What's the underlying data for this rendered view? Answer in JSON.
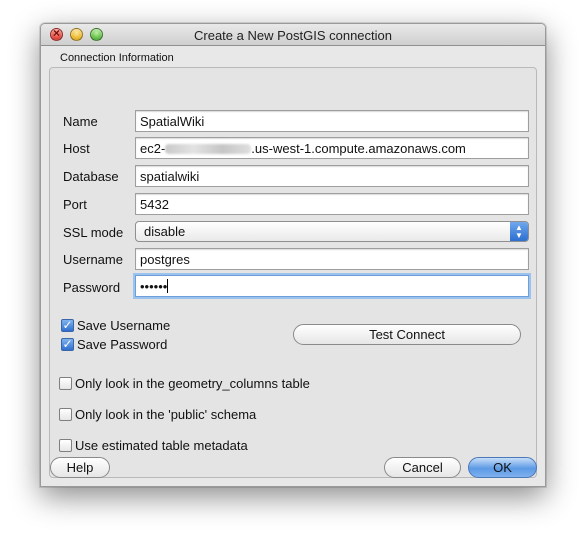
{
  "window": {
    "title": "Create a New PostGIS connection"
  },
  "group": {
    "label": "Connection Information"
  },
  "fields": {
    "name": {
      "label": "Name",
      "value": "SpatialWiki"
    },
    "host": {
      "label": "Host",
      "value_prefix": "ec2-",
      "value_suffix": ".us-west-1.compute.amazonaws.com"
    },
    "database": {
      "label": "Database",
      "value": "spatialwiki"
    },
    "port": {
      "label": "Port",
      "value": "5432"
    },
    "ssl_mode": {
      "label": "SSL mode",
      "value": "disable"
    },
    "username": {
      "label": "Username",
      "value": "postgres"
    },
    "password": {
      "label": "Password",
      "value": "••••••"
    }
  },
  "checkboxes": {
    "save_username": {
      "label": "Save Username",
      "checked": true
    },
    "save_password": {
      "label": "Save Password",
      "checked": true
    },
    "geometry_columns": {
      "label": "Only look in the geometry_columns table",
      "checked": false
    },
    "public_schema": {
      "label": "Only look in the 'public' schema",
      "checked": false
    },
    "estimated_metadata": {
      "label": "Use estimated table metadata",
      "checked": false
    }
  },
  "buttons": {
    "test_connect": "Test Connect",
    "help": "Help",
    "cancel": "Cancel",
    "ok": "OK"
  },
  "colors": {
    "accent": "#3b7fe0",
    "focus_ring": "#9cc2ee"
  },
  "icons": {
    "close": "close-icon",
    "minimize": "minimize-icon",
    "zoom": "zoom-icon",
    "select_arrows": "updown-arrows-icon",
    "check": "checkmark-icon"
  }
}
